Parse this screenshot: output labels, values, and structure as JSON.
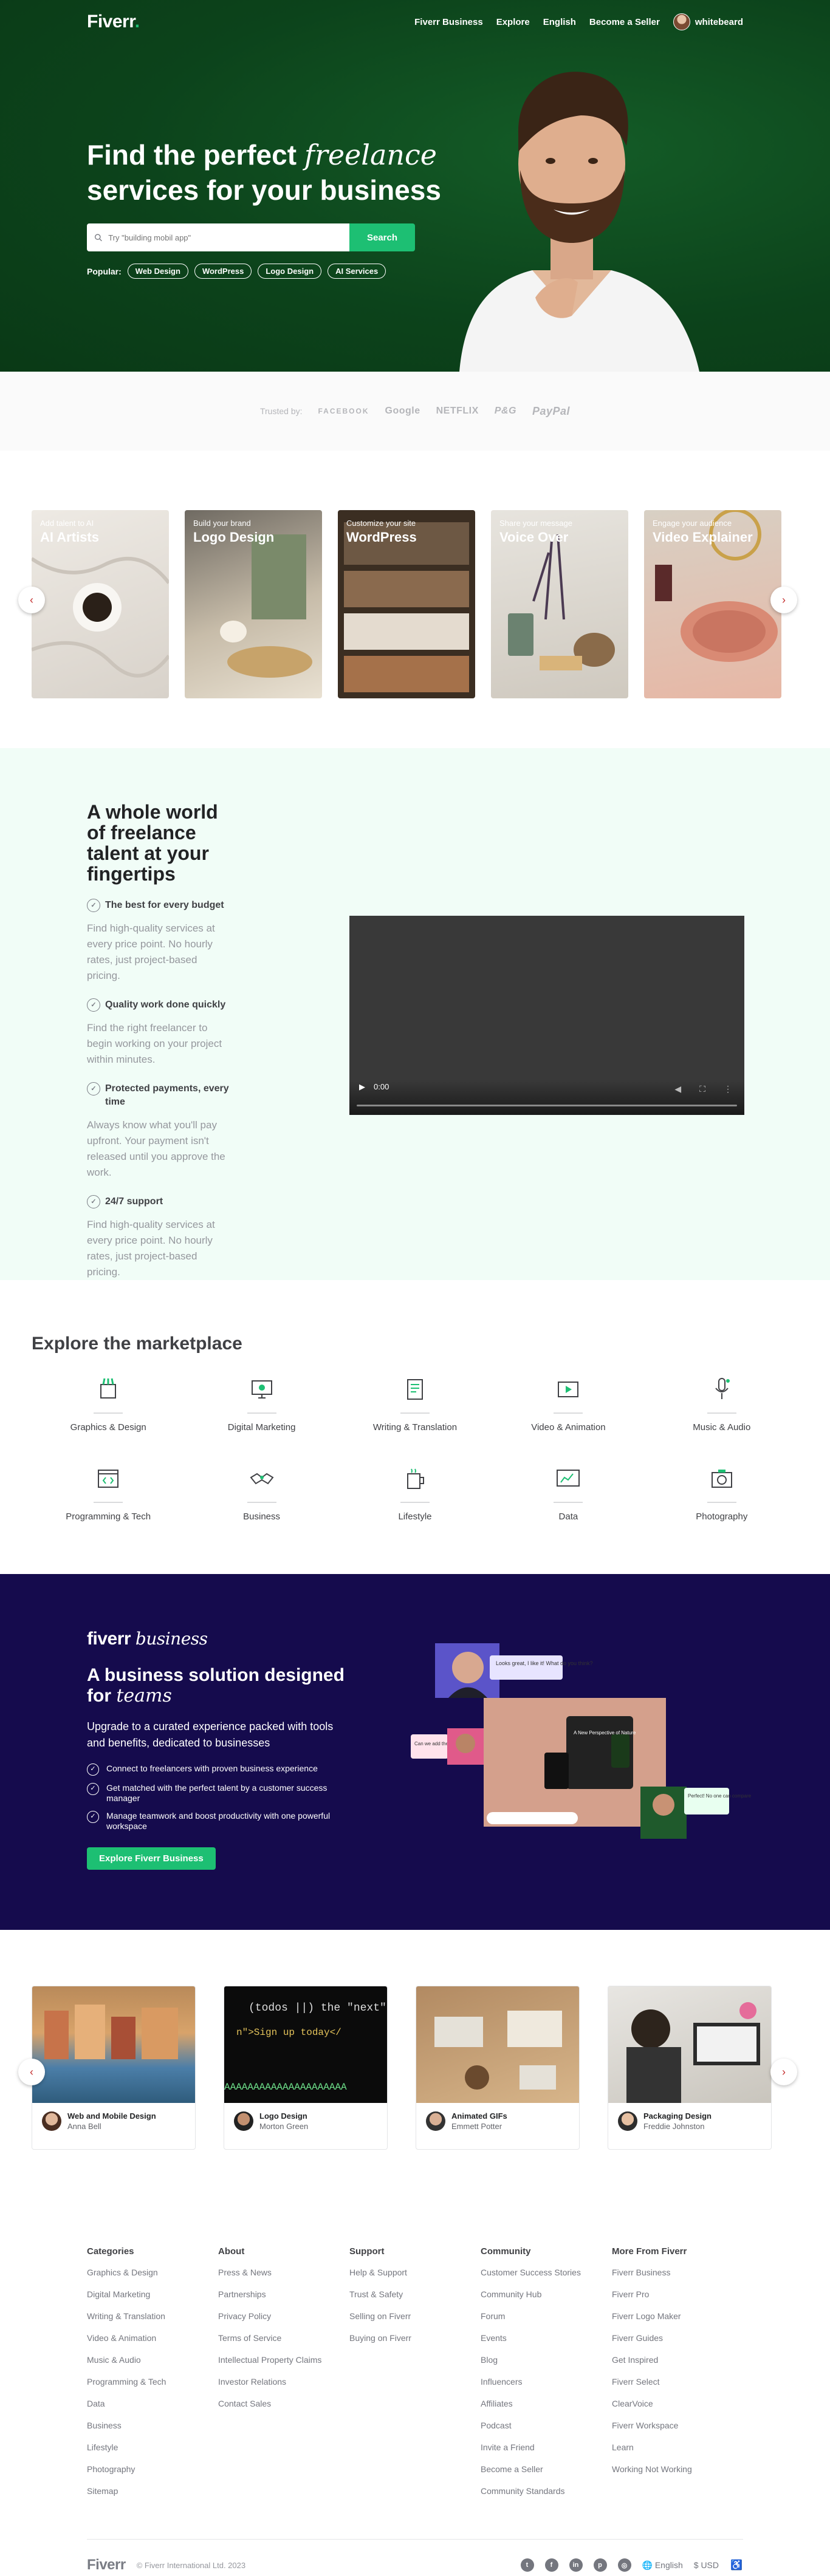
{
  "nav": {
    "logo": "Fiverr",
    "logo_dot": ".",
    "links": [
      "Fiverr Business",
      "Explore",
      "English",
      "Become a Seller"
    ],
    "username": "whitebeard"
  },
  "hero": {
    "title_part1": "Find the perfect ",
    "title_italic": "freelance",
    "title_part2": "services for your business",
    "search_placeholder": "Try \"building mobil app\"",
    "search_button": "Search",
    "popular_label": "Popular:",
    "popular_tags": [
      "Web Design",
      "WordPress",
      "Logo Design",
      "AI Services"
    ]
  },
  "trusted": {
    "label": "Trusted by:",
    "brands": [
      "FACEBOOK",
      "Google",
      "NETFLIX",
      "P&G",
      "PayPal"
    ]
  },
  "services": [
    {
      "sub": "Add talent to AI",
      "title": "AI Artists"
    },
    {
      "sub": "Build your brand",
      "title": "Logo Design"
    },
    {
      "sub": "Customize your site",
      "title": "WordPress"
    },
    {
      "sub": "Share your message",
      "title": "Voice Over"
    },
    {
      "sub": "Engage your audience",
      "title": "Video Explainer"
    }
  ],
  "value": {
    "title": "A whole world of freelance talent at your fingertips",
    "features": [
      {
        "title": "The best for every budget",
        "text": "Find high-quality services at every price point. No hourly rates, just project-based pricing."
      },
      {
        "title": "Quality work done quickly",
        "text": "Find the right freelancer to begin working on your project within minutes."
      },
      {
        "title": "Protected payments, every time",
        "text": "Always know what you'll pay upfront. Your payment isn't released until you approve the work."
      },
      {
        "title": "24/7 support",
        "text": "Find high-quality services at every price point. No hourly rates, just project-based pricing."
      }
    ],
    "video_time": "0:00"
  },
  "market": {
    "title": "Explore the marketplace",
    "categories": [
      "Graphics & Design",
      "Digital Marketing",
      "Writing & Translation",
      "Video & Animation",
      "Music & Audio",
      "Programming & Tech",
      "Business",
      "Lifestyle",
      "Data",
      "Photography"
    ]
  },
  "business": {
    "logo": "fiverr",
    "logo_italic": "business",
    "title_part1": "A business solution designed for ",
    "title_italic": "teams",
    "desc": "Upgrade to a curated experience packed with tools and benefits, dedicated to businesses",
    "items": [
      "Connect to freelancers with proven business experience",
      "Get matched with the perfect talent by a customer success manager",
      "Manage teamwork and boost productivity with one powerful workspace"
    ],
    "button": "Explore Fiverr Business",
    "bubble1": "Looks great, I like it! What do you think?",
    "bubble2": "Can we add the logo in green?",
    "bubble3": "Perfect! No one can compare!",
    "screen_text": "A New Perspective of Nature"
  },
  "projects": [
    {
      "title": "Web and Mobile Design",
      "name": "Anna Bell"
    },
    {
      "title": "Logo Design",
      "name": "Morton Green"
    },
    {
      "title": "Animated GIFs",
      "name": "Emmett Potter"
    },
    {
      "title": "Packaging Design",
      "name": "Freddie Johnston"
    }
  ],
  "footer": {
    "columns": [
      {
        "title": "Categories",
        "links": [
          "Graphics & Design",
          "Digital Marketing",
          "Writing & Translation",
          "Video & Animation",
          "Music & Audio",
          "Programming & Tech",
          "Data",
          "Business",
          "Lifestyle",
          "Photography",
          "Sitemap"
        ]
      },
      {
        "title": "About",
        "links": [
          "Press & News",
          "Partnerships",
          "Privacy Policy",
          "Terms of Service",
          "Intellectual Property Claims",
          "Investor Relations",
          "Contact Sales"
        ]
      },
      {
        "title": "Support",
        "links": [
          "Help & Support",
          "Trust & Safety",
          "Selling on Fiverr",
          "Buying on Fiverr"
        ]
      },
      {
        "title": "Community",
        "links": [
          "Customer Success Stories",
          "Community Hub",
          "Forum",
          "Events",
          "Blog",
          "Influencers",
          "Affiliates",
          "Podcast",
          "Invite a Friend",
          "Become a Seller",
          "Community Standards"
        ]
      },
      {
        "title": "More From Fiverr",
        "links": [
          "Fiverr Business",
          "Fiverr Pro",
          "Fiverr Logo Maker",
          "Fiverr Guides",
          "Get Inspired",
          "Fiverr Select",
          "ClearVoice",
          "Fiverr Workspace",
          "Learn",
          "Working Not Working"
        ]
      }
    ],
    "logo": "Fiverr",
    "copyright": "© Fiverr International Ltd. 2023",
    "language": "English",
    "currency": "USD"
  },
  "colors": {
    "brand_green": "#1dbf73",
    "hero_bg": "#0d4a1f",
    "business_bg": "#150b4d",
    "value_bg": "#f1fdf7"
  }
}
